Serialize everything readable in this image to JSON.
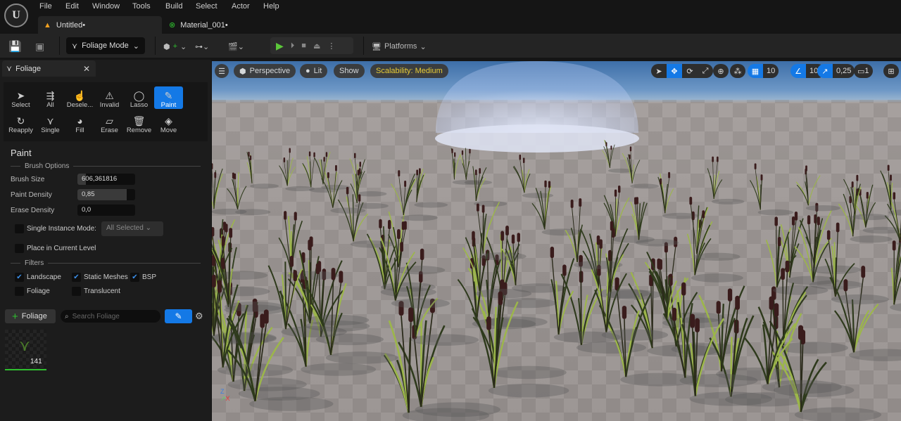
{
  "menu": [
    "File",
    "Edit",
    "Window",
    "Tools",
    "Build",
    "Select",
    "Actor",
    "Help"
  ],
  "tabs": [
    {
      "label": "Untitled•",
      "icon": "level-icon"
    },
    {
      "label": "Material_001•",
      "icon": "material-icon"
    }
  ],
  "toolbar": {
    "mode": "Foliage Mode",
    "platforms": "Platforms"
  },
  "panel": {
    "tab": "Foliage",
    "tools": [
      "Select",
      "All",
      "Desele...",
      "Invalid",
      "Lasso",
      "Paint",
      "Reapply",
      "Single",
      "Fill",
      "Erase",
      "Remove",
      "Move"
    ],
    "tool_icons": [
      "➤",
      "⇶",
      "☝",
      "⚠",
      "◯",
      "✎",
      "↻",
      "⋎",
      "◕",
      "▱",
      "🗑",
      "◈"
    ],
    "active_tool": "Paint",
    "section": "Paint",
    "brush_options": "Brush Options",
    "brush_size_label": "Brush Size",
    "brush_size": "606,361816",
    "paint_density_label": "Paint Density",
    "paint_density": "0,85",
    "erase_density_label": "Erase Density",
    "erase_density": "0,0",
    "single_instance": "Single Instance Mode:",
    "single_instance_value": "All Selected",
    "place_current": "Place in Current Level",
    "filters": "Filters",
    "filter_items": [
      {
        "label": "Landscape",
        "checked": true
      },
      {
        "label": "Static Meshes",
        "checked": true
      },
      {
        "label": "BSP",
        "checked": true
      },
      {
        "label": "Foliage",
        "checked": false
      },
      {
        "label": "Translucent",
        "checked": false
      }
    ],
    "add_foliage": "Foliage",
    "search_placeholder": "Search Foliage",
    "foliage_count": "141"
  },
  "viewport": {
    "perspective": "Perspective",
    "lit": "Lit",
    "show": "Show",
    "scalability": "Scalability: Medium",
    "grid_snap": "10",
    "rot_snap": "10°",
    "scale_snap": "0,25",
    "camera_speed": "1",
    "accent": "#1479e6"
  }
}
